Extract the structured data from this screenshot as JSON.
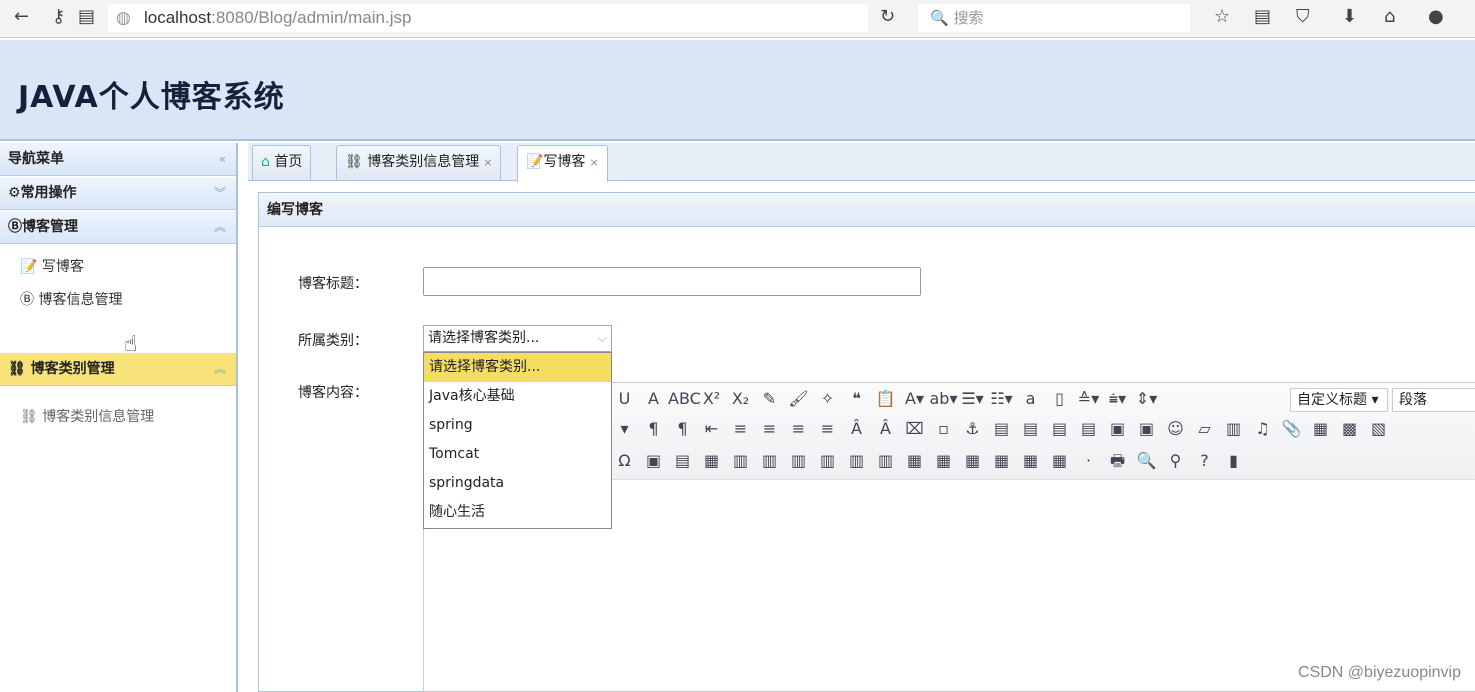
{
  "browser": {
    "url_host": "localhost",
    "url_rest": ":8080/Blog/admin/main.jsp",
    "search_placeholder": "搜索"
  },
  "header": {
    "title": "JAVA个人博客系统"
  },
  "sidebar": {
    "title": "导航菜单",
    "sections": [
      {
        "label": "常用操作"
      },
      {
        "label": "博客管理",
        "items": [
          {
            "label": "写博客"
          },
          {
            "label": "博客信息管理"
          }
        ]
      },
      {
        "label": "博客类别管理",
        "items": [
          {
            "label": "博客类别信息管理"
          }
        ]
      }
    ]
  },
  "tabs": [
    {
      "label": "首页"
    },
    {
      "label": "博客类别信息管理"
    },
    {
      "label": "写博客"
    }
  ],
  "panel": {
    "title": "编写博客"
  },
  "form": {
    "title_label": "博客标题：",
    "title_value": "",
    "category_label": "所属类别：",
    "category_selected": "请选择博客类别...",
    "category_options": [
      "请选择博客类别...",
      "Java核心基础",
      "spring",
      "Tomcat",
      "springdata",
      "随心生活"
    ],
    "content_label": "博客内容："
  },
  "editor": {
    "heading_select": "自定义标题",
    "paragraph_select": "段落",
    "row1": [
      "U",
      "A",
      "ABC",
      "X²",
      "X₂",
      "✎",
      "🖌",
      "✧",
      "❝",
      "📋",
      "A▾",
      "ab▾",
      "☰▾",
      "☷▾",
      "a",
      "▯",
      "≙▾",
      "⩧▾",
      "⇕▾"
    ],
    "row2": [
      "▾",
      "¶",
      "¶",
      "⇤",
      "≡",
      "≡",
      "≡",
      "≡",
      "Â",
      "Â",
      "⌧",
      "▫",
      "⚓",
      "▤",
      "▤",
      "▤",
      "▤",
      "▣",
      "▣",
      "☺",
      "▱",
      "▥",
      "♫",
      "📎",
      "▦",
      "▩",
      "▧"
    ],
    "row3": [
      "Ω",
      "▣",
      "▤",
      "▦",
      "▥",
      "▥",
      "▥",
      "▥",
      "▥",
      "▥",
      "▦",
      "▦",
      "▦",
      "▦",
      "▦",
      "▦",
      "·",
      "🖶",
      "🔍",
      "⚲",
      "?",
      "▮"
    ]
  },
  "watermark": "CSDN @biyezuopinvip"
}
